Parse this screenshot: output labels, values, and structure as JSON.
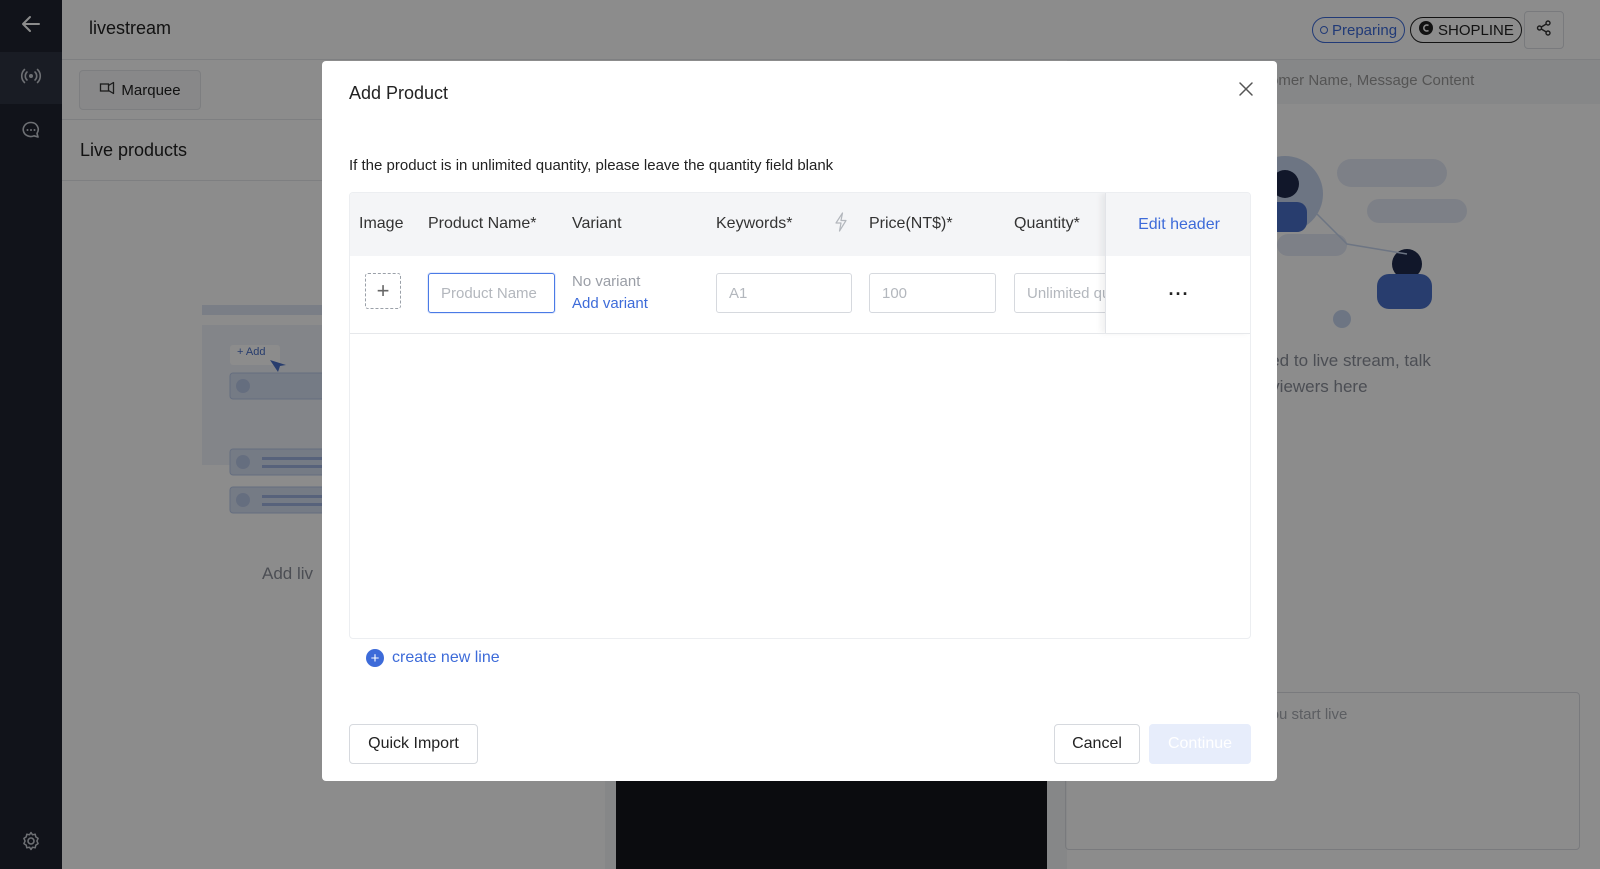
{
  "app": {
    "title": "livestream"
  },
  "status": {
    "preparing": "Preparing",
    "platform": "SHOPLINE"
  },
  "toolbar": {
    "marquee_label": "Marquee"
  },
  "comments": {
    "search_placeholder": "omer Name, Message Content",
    "empty_text_line1": "cted to live stream, talk",
    "empty_text_line2": "n viewers here",
    "input_placeholder": "r you start live"
  },
  "live_products": {
    "title": "Live products",
    "add_text": "Add liv",
    "illus_add_label": "+ Add"
  },
  "modal": {
    "title": "Add Product",
    "hint": "If the product is in unlimited quantity, please leave the quantity field blank",
    "columns": {
      "image": "Image",
      "product_name": "Product Name*",
      "variant": "Variant",
      "keywords": "Keywords*",
      "price": "Price(NT$)*",
      "quantity": "Quantity*",
      "edit_header": "Edit header"
    },
    "row": {
      "product_name_placeholder": "Product Name",
      "variant_none": "No variant",
      "add_variant": "Add variant",
      "keywords_placeholder": "A1",
      "price_placeholder": "100",
      "quantity_placeholder": "Unlimited quantity",
      "more": "···"
    },
    "create_new_line": "create new line",
    "buttons": {
      "quick_import": "Quick Import",
      "cancel": "Cancel",
      "continue": "Continue"
    }
  },
  "colors": {
    "accent": "#3d6bd9",
    "rail": "#1f2430",
    "overlay": "rgba(0,0,0,0.45)"
  },
  "icons": {
    "back": "arrow-left-icon",
    "live": "broadcast-icon",
    "chat": "chat-icon",
    "settings": "gear-icon",
    "share": "share-icon",
    "close": "close-icon",
    "bolt": "lightning-icon",
    "plus": "plus-icon"
  }
}
